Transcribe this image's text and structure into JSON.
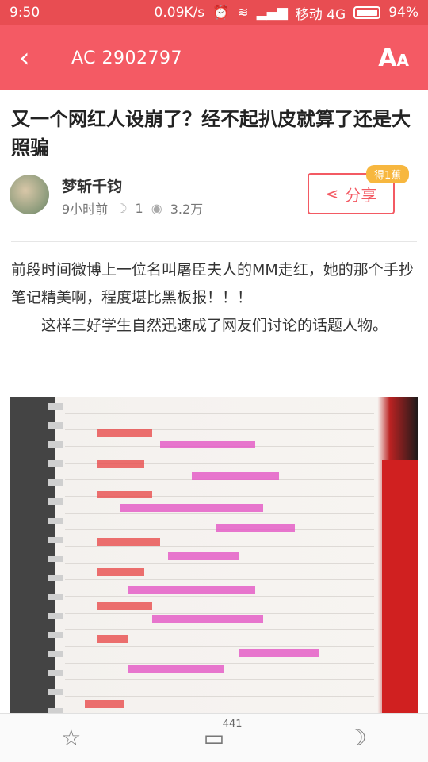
{
  "status": {
    "time": "9:50",
    "speed": "0.09K/s",
    "carrier": "移动 4G",
    "battery": "94%"
  },
  "header": {
    "title": "AC 2902797"
  },
  "article": {
    "title": "又一个网红人设崩了？经不起扒皮就算了还是大照骗",
    "author": "梦斩千钧",
    "time_ago": "9小时前",
    "banana_count": "1",
    "views": "3.2万",
    "share_label": "分享",
    "reward_badge": "得1蕉",
    "paragraph1": "前段时间微博上一位名叫屠臣夫人的MM走红，她的那个手抄笔记精美啊，程度堪比黑板报！！！",
    "paragraph2": "这样三好学生自然迅速成了网友们讨论的话题人物。"
  },
  "bottom_bar": {
    "comments": "441"
  },
  "colors": {
    "accent": "#f45a64",
    "status_bar": "#e84d52",
    "badge": "#f7b73f",
    "highlight": "#e455c4"
  },
  "icons": [
    "back-arrow-icon",
    "font-size-icon",
    "share-icon",
    "star-icon",
    "comment-icon",
    "banana-icon",
    "eye-icon"
  ]
}
